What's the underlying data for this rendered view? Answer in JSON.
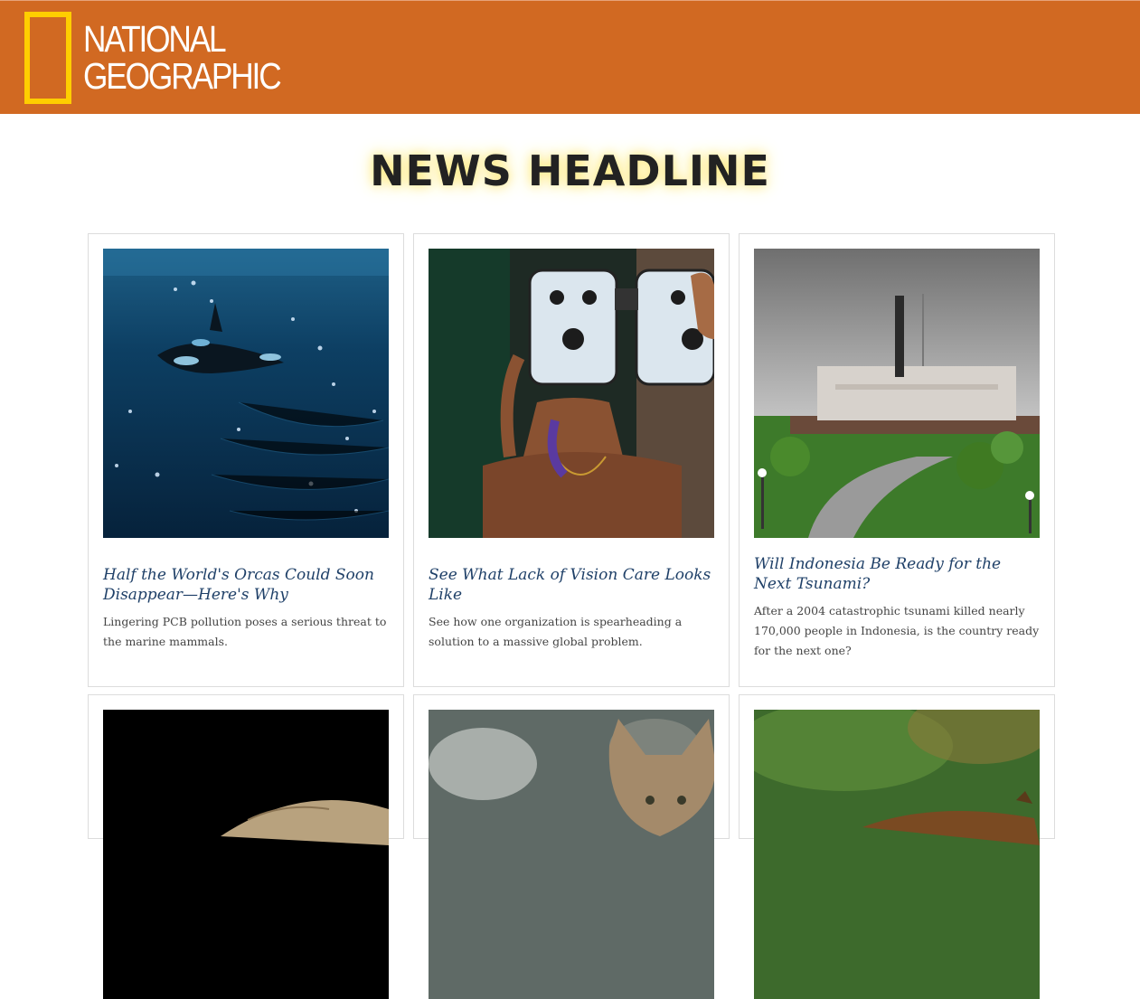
{
  "brand": {
    "line1": "NATIONAL",
    "line2": "GEOGRAPHIC",
    "header_color": "#d16922",
    "frame_color": "#ffce00"
  },
  "page": {
    "headline": "NEWS HEADLINE"
  },
  "articles": [
    {
      "title": "Half the World's Orcas Could Soon Disappear—Here's Why",
      "description": "Lingering PCB pollution poses a serious threat to the marine mammals.",
      "image": "orca-underwater-photo"
    },
    {
      "title": "See What Lack of Vision Care Looks Like",
      "description": "See how one organization is spearheading a solution to a massive global problem.",
      "image": "woman-eye-test-photo"
    },
    {
      "title": "Will Indonesia Be Ready for the Next Tsunami?",
      "description": "After a 2004 catastrophic tsunami killed nearly 170,000 people in Indonesia, is the country ready for the next one?",
      "image": "ship-on-land-photo"
    },
    {
      "image": "tortoise-photo"
    },
    {
      "image": "lynx-photo"
    },
    {
      "image": "animal-in-grass-photo"
    }
  ]
}
